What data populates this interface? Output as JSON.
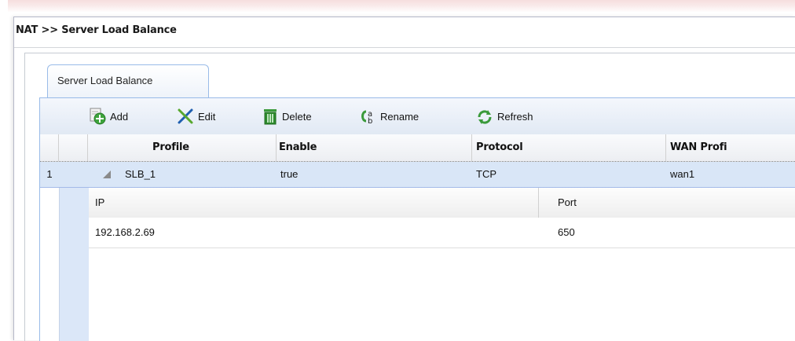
{
  "breadcrumb": "NAT >> Server Load Balance",
  "tab": {
    "label": "Server Load Balance"
  },
  "toolbar": {
    "buttons": [
      {
        "label": "Add",
        "icon": "add-icon"
      },
      {
        "label": "Edit",
        "icon": "edit-icon"
      },
      {
        "label": "Delete",
        "icon": "delete-icon"
      },
      {
        "label": "Rename",
        "icon": "rename-icon"
      },
      {
        "label": "Refresh",
        "icon": "refresh-icon"
      }
    ]
  },
  "grid": {
    "columns": [
      "Profile",
      "Enable",
      "Protocol",
      "WAN Profi"
    ],
    "rows": [
      {
        "index": "1",
        "profile": "SLB_1",
        "enable": "true",
        "protocol": "TCP",
        "wan": "wan1"
      }
    ]
  },
  "subgrid": {
    "columns": [
      "IP",
      "Port"
    ],
    "rows": [
      {
        "ip": "192.168.2.69",
        "port": "650"
      }
    ]
  },
  "colors": {
    "accent": "#99bbe8",
    "selected_row": "#d9e6f7",
    "toolbar_bg": "#e1e9f4"
  }
}
